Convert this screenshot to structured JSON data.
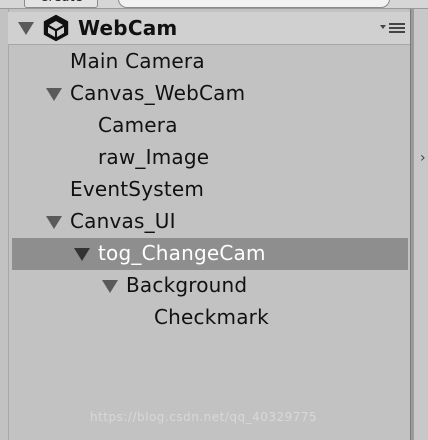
{
  "toolbar": {
    "create_label": "Create",
    "search_placeholder": ""
  },
  "scene": {
    "name": "WebCam",
    "menu_icon": "context-menu-icon"
  },
  "hierarchy": [
    {
      "label": "Main Camera",
      "depth": 1,
      "expanded": null,
      "selected": false
    },
    {
      "label": "Canvas_WebCam",
      "depth": 1,
      "expanded": true,
      "selected": false
    },
    {
      "label": "Camera",
      "depth": 2,
      "expanded": null,
      "selected": false
    },
    {
      "label": "raw_Image",
      "depth": 2,
      "expanded": null,
      "selected": false
    },
    {
      "label": "EventSystem",
      "depth": 1,
      "expanded": null,
      "selected": false
    },
    {
      "label": "Canvas_UI",
      "depth": 1,
      "expanded": true,
      "selected": false
    },
    {
      "label": "tog_ChangeCam",
      "depth": 2,
      "expanded": true,
      "selected": true
    },
    {
      "label": "Background",
      "depth": 3,
      "expanded": true,
      "selected": false
    },
    {
      "label": "Checkmark",
      "depth": 4,
      "expanded": null,
      "selected": false
    }
  ],
  "colors": {
    "panel_bg": "#c2c2c2",
    "selection_bg": "#8e8e8e",
    "selected_text": "#ffffff",
    "text": "#111111"
  },
  "watermark": "https://blog.csdn.net/qq_40329775"
}
